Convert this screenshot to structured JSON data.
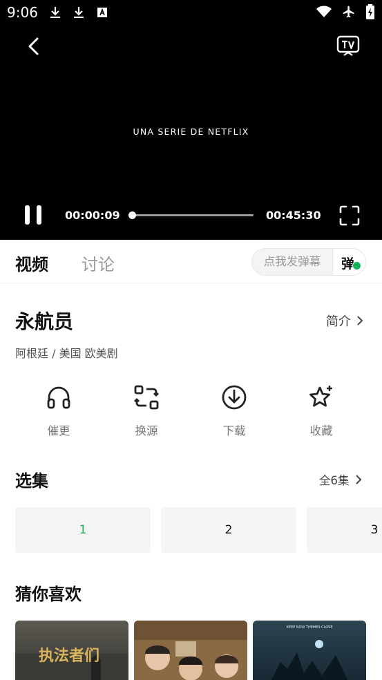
{
  "status_bar": {
    "time": "9:06",
    "left_icons": [
      "download-icon",
      "download-icon",
      "text-a-icon"
    ],
    "right_icons": [
      "wifi-icon",
      "airplane-icon",
      "battery-charging-icon"
    ]
  },
  "player": {
    "video_caption": "UNA SERIE DE NETFLIX",
    "time_current": "00:00:09",
    "time_total": "00:45:30",
    "progress_fraction": 0.003
  },
  "tabs": [
    {
      "label": "视频",
      "active": true
    },
    {
      "label": "讨论",
      "active": false
    }
  ],
  "danmu": {
    "input_placeholder": "点我发弹幕",
    "toggle_label": "弹",
    "enabled": true
  },
  "show": {
    "title": "永航员",
    "intro_label": "简介",
    "meta": "阿根廷 / 美国  欧美剧"
  },
  "actions": [
    {
      "label": "催更",
      "icon": "headphones-icon"
    },
    {
      "label": "换源",
      "icon": "switch-source-icon"
    },
    {
      "label": "下载",
      "icon": "download-circle-icon"
    },
    {
      "label": "收藏",
      "icon": "star-icon"
    }
  ],
  "episodes": {
    "title": "选集",
    "all_label": "全6集",
    "items": [
      {
        "label": "1",
        "selected": true
      },
      {
        "label": "2",
        "selected": false
      },
      {
        "label": "3",
        "selected": false
      }
    ]
  },
  "recommendations": {
    "title": "猜你喜欢",
    "posters": [
      {
        "title_text": "执法者们"
      },
      {
        "title_text": ""
      },
      {
        "title_text": "KEEP NOW THEMES CLOSE"
      }
    ]
  },
  "colors": {
    "accent_green": "#1ab35b",
    "player_bg": "#000000",
    "text_primary": "#111111",
    "text_secondary": "#777777"
  }
}
